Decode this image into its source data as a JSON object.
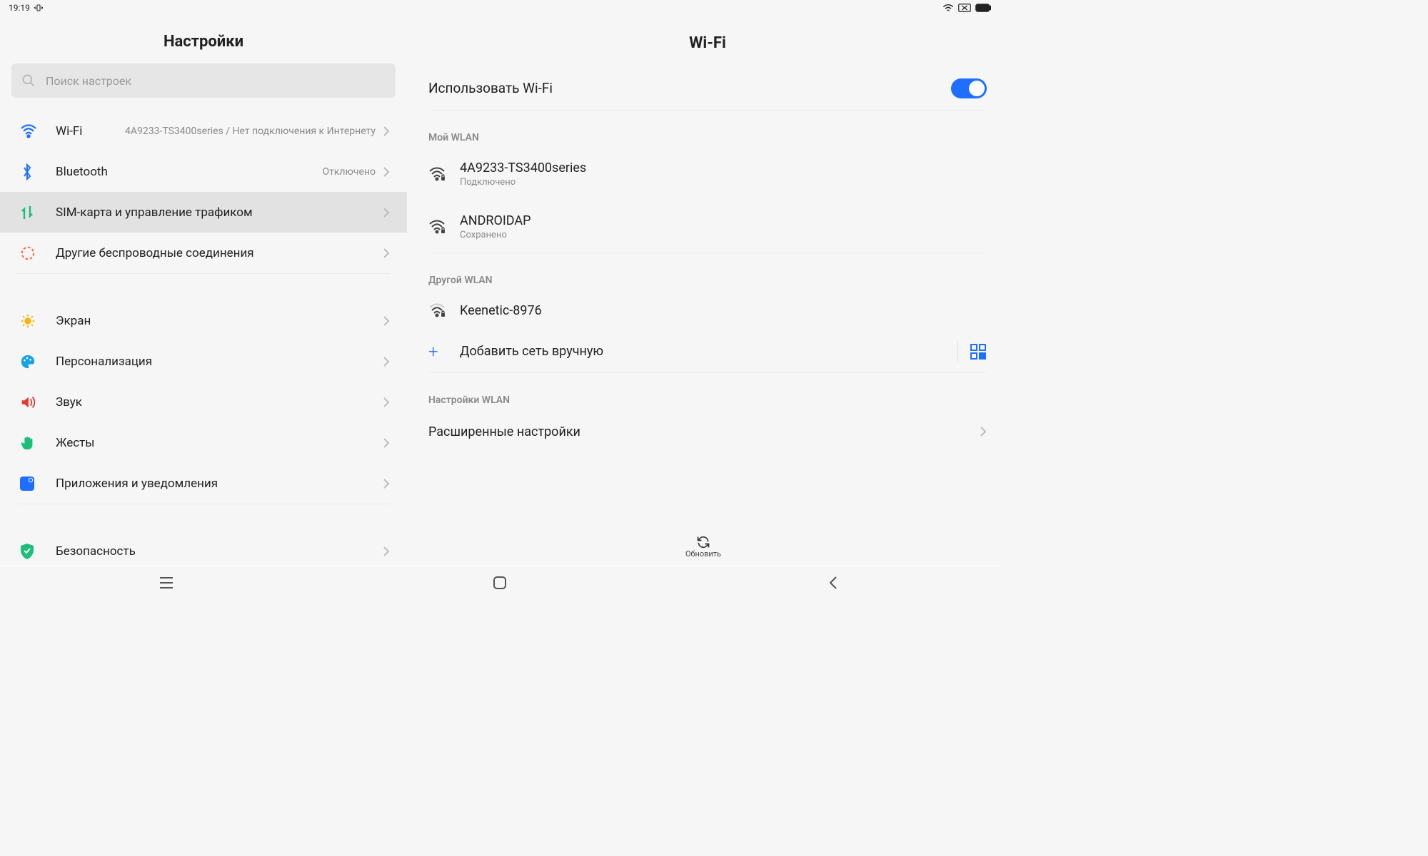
{
  "statusbar": {
    "time": "19:19"
  },
  "left": {
    "title": "Настройки",
    "search_placeholder": "Поиск настроек",
    "items": [
      {
        "label": "Wi-Fi",
        "sublabel": "4A9233-TS3400series / Нет подключения к Интернету"
      },
      {
        "label": "Bluetooth",
        "sublabel": "Отключено"
      },
      {
        "label": "SIM-карта и управление трафиком"
      },
      {
        "label": "Другие беспроводные соединения"
      },
      {
        "label": "Экран"
      },
      {
        "label": "Персонализация"
      },
      {
        "label": "Звук"
      },
      {
        "label": "Жесты"
      },
      {
        "label": "Приложения и уведомления"
      },
      {
        "label": "Безопасность"
      }
    ]
  },
  "right": {
    "title": "Wi-Fi",
    "toggle_label": "Использовать Wi-Fi",
    "toggle_on": true,
    "my_wlan_header": "Мой WLAN",
    "my_networks": [
      {
        "name": "4A9233-TS3400series",
        "status": "Подключено"
      },
      {
        "name": "ANDROIDAP",
        "status": "Сохранено"
      }
    ],
    "other_wlan_header": "Другой WLAN",
    "other_networks": [
      {
        "name": "Keenetic-8976"
      }
    ],
    "add_network_label": "Добавить сеть вручную",
    "wlan_settings_header": "Настройки WLAN",
    "advanced_label": "Расширенные настройки",
    "refresh_label": "Обновить"
  }
}
